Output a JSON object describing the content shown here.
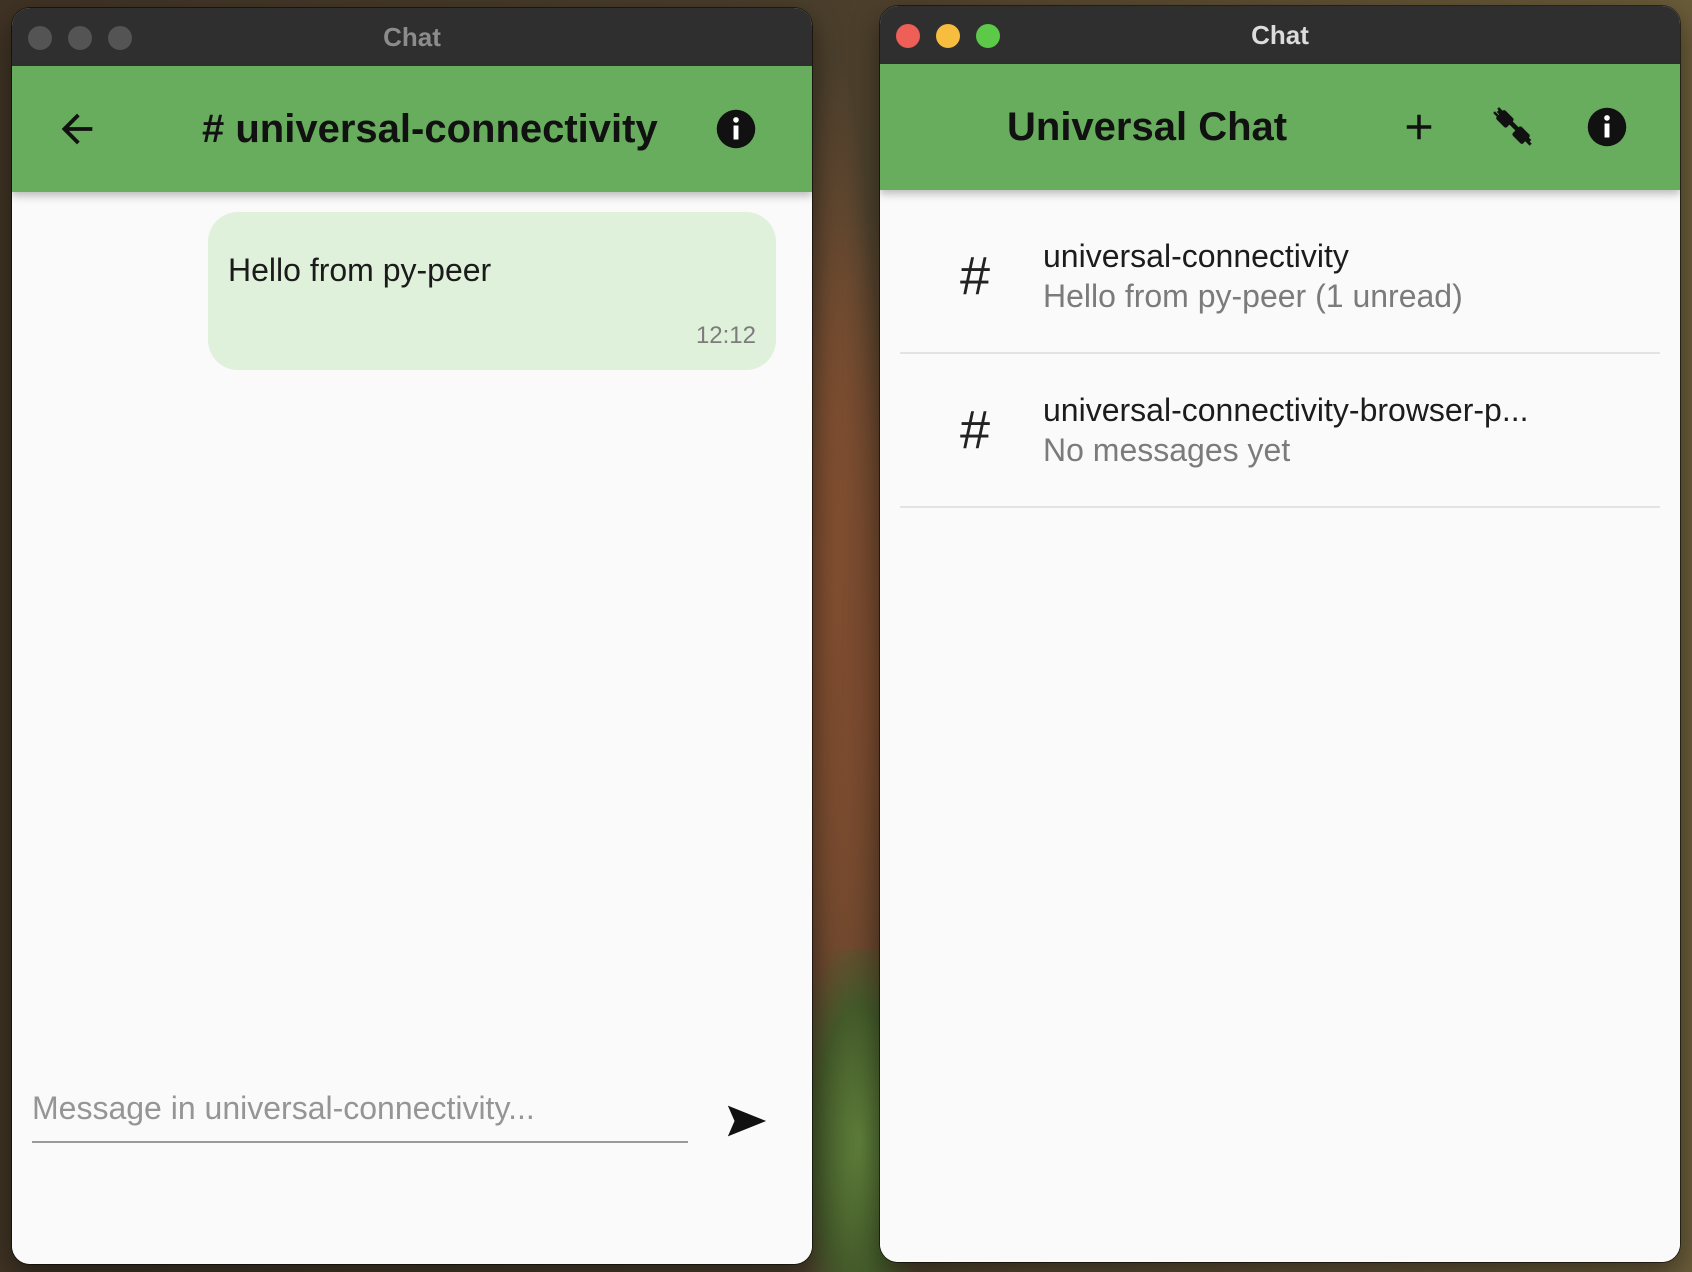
{
  "left_window": {
    "title": "Chat",
    "appbar": {
      "title": "# universal-connectivity",
      "back_icon": "arrow-back-icon",
      "info_icon": "info-icon"
    },
    "messages": [
      {
        "text": "Hello from py-peer",
        "time": "12:12"
      }
    ],
    "composer": {
      "placeholder": "Message in universal-connectivity...",
      "value": "",
      "send_icon": "send-icon"
    }
  },
  "right_window": {
    "title": "Chat",
    "appbar": {
      "title": "Universal Chat",
      "add_icon": "add-icon",
      "plug_icon": "disconnect-plug-icon",
      "info_icon": "info-icon"
    },
    "channels": [
      {
        "icon": "#",
        "name": "universal-connectivity",
        "subtitle": "Hello from py-peer (1 unread)"
      },
      {
        "icon": "#",
        "name": "universal-connectivity-browser-p...",
        "subtitle": "No messages yet"
      }
    ]
  },
  "colors": {
    "appbar": "#68ad5d",
    "bubble": "#dff1da",
    "traffic_red": "#ed5f57",
    "traffic_yellow": "#f6bd3f",
    "traffic_green": "#5cc948"
  }
}
